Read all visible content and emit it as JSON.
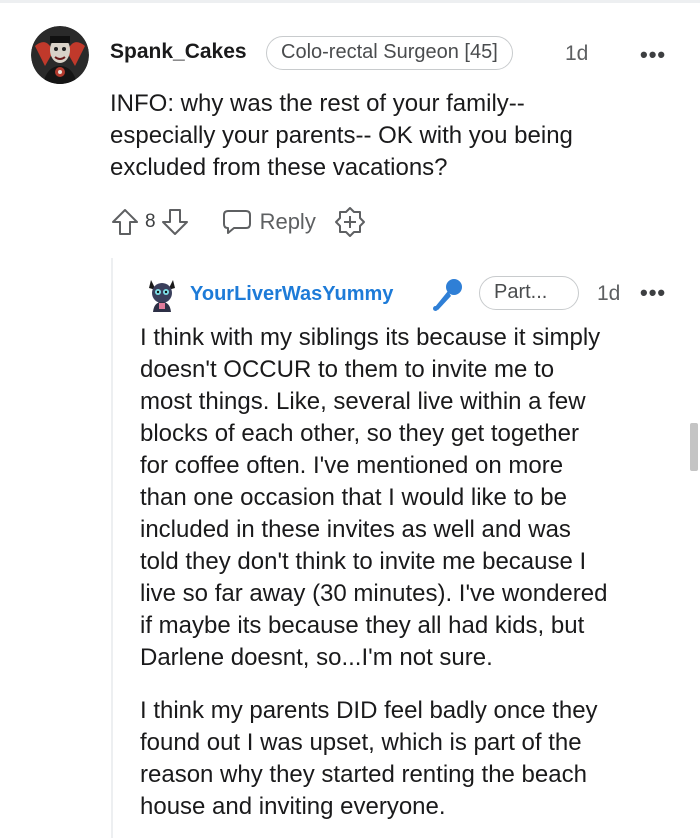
{
  "parent_comment": {
    "username": "Spank_Cakes",
    "flair": "Colo-rectal Surgeon [45]",
    "time": "1d",
    "more_label": "•••",
    "body": "INFO: why was the rest of your family--\nespecially your parents-- OK with you being\nexcluded from these vacations?",
    "vote_count": "8",
    "reply_label": "Reply"
  },
  "reply_comment": {
    "username": "YourLiverWasYummy",
    "flair": "Part...",
    "time": "1d",
    "more_label": "•••",
    "paragraph_1": "I think with my siblings its because it simply\ndoesn't OCCUR to them to invite me to\nmost things. Like, several live within a few\nblocks of each other, so they get together\nfor coffee often. I've mentioned on more\nthan one occasion that I would like to be\nincluded in these invites as well and was\ntold they don't think to invite me because I\nlive so far away (30 minutes). I've wondered\nif maybe its because they all had kids, but\nDarlene doesnt, so...I'm not sure.",
    "paragraph_2": "I think my parents DID feel badly once they\nfound out I was upset, which is part of the\nreason why they started renting the beach\nhouse and inviting everyone."
  },
  "icons": {
    "upvote": "upvote-arrow-icon",
    "downvote": "downvote-arrow-icon",
    "reply": "speech-bubble-icon",
    "award": "plus-award-icon",
    "mic": "microphone-icon"
  },
  "colors": {
    "reply_username": "#1d7bd8",
    "mic": "#2f7fd6"
  }
}
